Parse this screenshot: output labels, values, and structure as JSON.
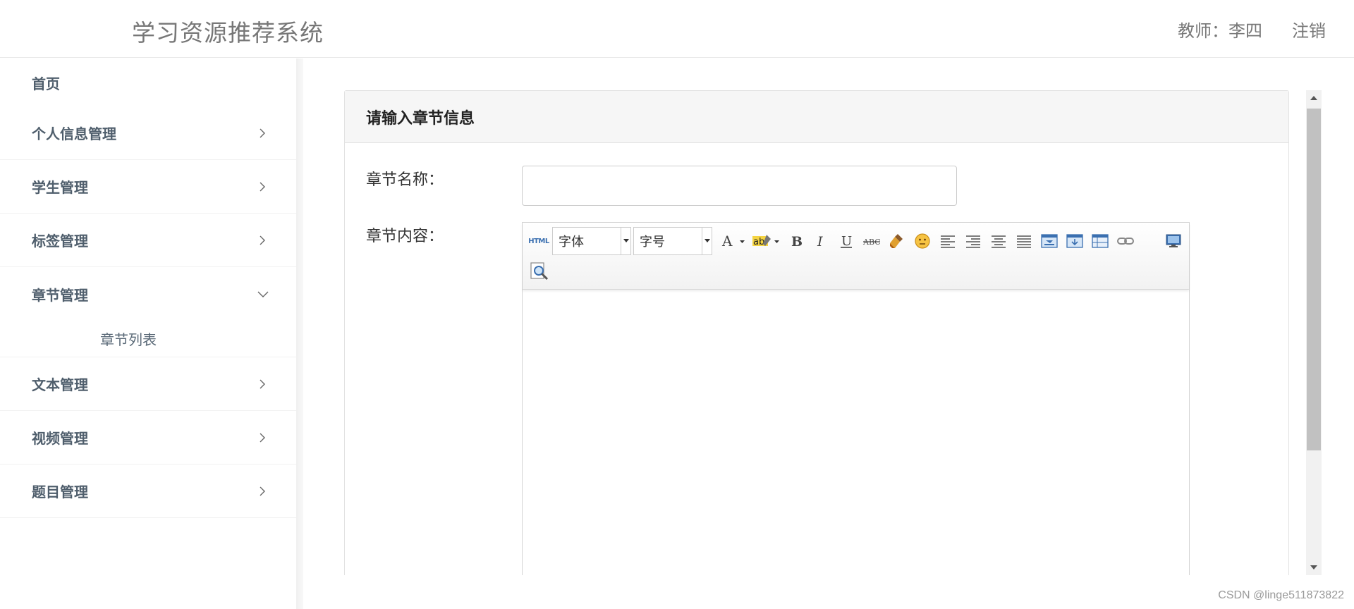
{
  "header": {
    "app_title": "学习资源推荐系统",
    "user_label": "教师：李四",
    "logout_label": "注销"
  },
  "sidebar": {
    "home": "首页",
    "items": [
      {
        "label": "个人信息管理",
        "expanded": false
      },
      {
        "label": "学生管理",
        "expanded": false
      },
      {
        "label": "标签管理",
        "expanded": false
      },
      {
        "label": "章节管理",
        "expanded": true,
        "children": [
          "章节列表"
        ]
      },
      {
        "label": "文本管理",
        "expanded": false
      },
      {
        "label": "视频管理",
        "expanded": false
      },
      {
        "label": "题目管理",
        "expanded": false
      }
    ]
  },
  "form": {
    "heading": "请输入章节信息",
    "name_label": "章节名称：",
    "name_value": "",
    "content_label": "章节内容："
  },
  "editor": {
    "html_button": "HTML",
    "font_select": "字体",
    "size_select": "字号"
  },
  "watermark": "CSDN @linge511873822",
  "colors": {
    "sidebar_text": "#4f5e6c",
    "header_text": "#777777",
    "panel_heading_bg": "#f6f6f6"
  }
}
